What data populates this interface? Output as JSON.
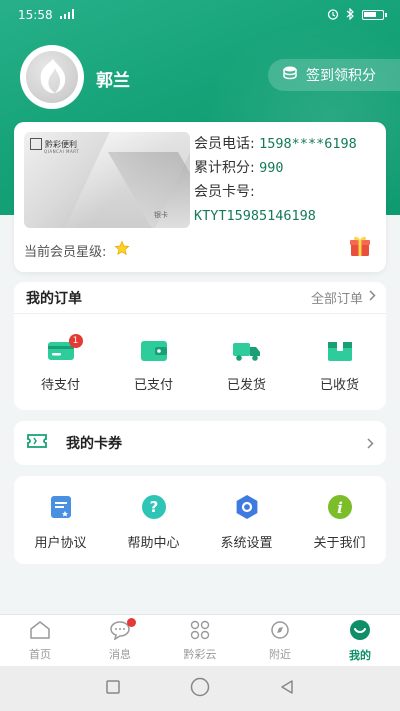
{
  "status_bar": {
    "time": "15:58",
    "signal": "4G",
    "battery": "battery"
  },
  "profile": {
    "name": "郭兰"
  },
  "signin": {
    "label": "签到领积分"
  },
  "member_card": {
    "brand": "黔彩便利",
    "brand_en": "QIANCAI MART",
    "tier_label": "银卡",
    "phone_label": "会员电话:",
    "phone_value": "1598****6198",
    "points_label": "累计积分:",
    "points_value": "990",
    "card_no_label": "会员卡号:",
    "card_no_value": "KTYT15985146198",
    "star_label": "当前会员星级:"
  },
  "orders": {
    "title": "我的订单",
    "all_label": "全部订单",
    "items": [
      {
        "label": "待支付",
        "badge": "1"
      },
      {
        "label": "已支付"
      },
      {
        "label": "已发货"
      },
      {
        "label": "已收货"
      }
    ]
  },
  "coupons": {
    "title": "我的卡券"
  },
  "services": {
    "items": [
      {
        "label": "用户协议"
      },
      {
        "label": "帮助中心"
      },
      {
        "label": "系统设置"
      },
      {
        "label": "关于我们"
      }
    ]
  },
  "tabs": [
    {
      "label": "首页"
    },
    {
      "label": "消息"
    },
    {
      "label": "黔彩云"
    },
    {
      "label": "附近"
    },
    {
      "label": "我的"
    }
  ],
  "colors": {
    "primary": "#14a176",
    "accent_text": "#157a5c",
    "badge": "#e53935"
  }
}
